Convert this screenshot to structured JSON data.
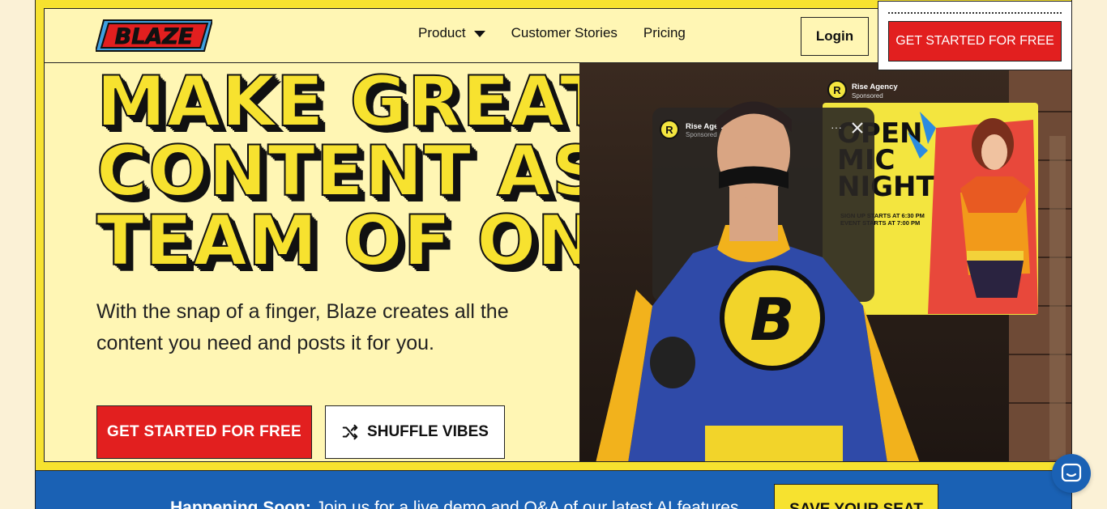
{
  "brand": {
    "logo_text": "BLAZE"
  },
  "nav": {
    "items": [
      {
        "label": "Product",
        "has_dropdown": true
      },
      {
        "label": "Customer Stories"
      },
      {
        "label": "Pricing"
      }
    ],
    "login_label": "Login"
  },
  "popup": {
    "cta_label": "GET STARTED FOR FREE"
  },
  "hero": {
    "title_lines": [
      "MAKE GREAT",
      "CONTENT AS A",
      "TEAM OF ONE"
    ],
    "subtitle": "With the snap of a finger, Blaze creates all the content you need and posts it for you.",
    "cta_primary": "GET STARTED FOR FREE",
    "cta_secondary": "SHUFFLE VIBES",
    "image": {
      "ad_front": {
        "account": "Rise Agency",
        "tag": "Sponsored"
      },
      "ad_back": {
        "account": "Rise Agency",
        "tag": "Sponsored",
        "headline_lines": [
          "OPEN",
          "MIC",
          "NIGHT"
        ],
        "detail_lines": [
          "SIGN UP STARTS AT 6:30 PM",
          "EVENT STARTS AT 7:00 PM"
        ]
      },
      "badge_letter": "B"
    }
  },
  "banner": {
    "lead": "Happening Soon:",
    "text": " Join us for a live demo and Q&A of our latest AI features",
    "button": "SAVE YOUR SEAT"
  },
  "colors": {
    "yellow": "#f7e22f",
    "cream": "#fff6b4",
    "red": "#e21f1f",
    "blue": "#1a61b4"
  }
}
